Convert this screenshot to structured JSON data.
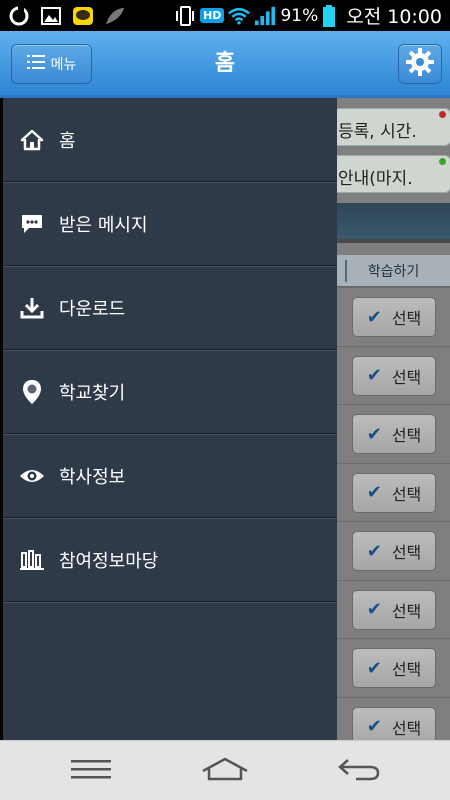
{
  "status_bar": {
    "battery_percent": "91%",
    "clock": "오전 10:00",
    "hd_badge": "HD",
    "icons": [
      "notification-app-icon",
      "gallery-icon",
      "kakaotalk-icon",
      "feather-icon",
      "vibrate-icon",
      "wifi-icon",
      "signal-icon",
      "battery-icon"
    ]
  },
  "header": {
    "menu_label": "메뉴",
    "title": "홈",
    "settings_icon": "gear-icon"
  },
  "drawer": {
    "items": [
      {
        "label": "홈",
        "icon": "home-icon"
      },
      {
        "label": "받은 메시지",
        "icon": "message-icon"
      },
      {
        "label": "다운로드",
        "icon": "download-icon"
      },
      {
        "label": "학교찾기",
        "icon": "location-pin-icon"
      },
      {
        "label": "학사정보",
        "icon": "eye-info-icon"
      },
      {
        "label": "참여정보마당",
        "icon": "bar-chart-icon"
      }
    ]
  },
  "background": {
    "notices": [
      {
        "text": "등록, 시간.",
        "dot_color": "#c0282d"
      },
      {
        "text": "안내(마지.",
        "dot_color": "#3aa52f"
      }
    ],
    "column_header": "학습하기",
    "select_label": "선택",
    "select_rows": 8
  },
  "colors": {
    "header_blue": "#3b8fd8",
    "drawer_bg": "#2f3a48"
  }
}
